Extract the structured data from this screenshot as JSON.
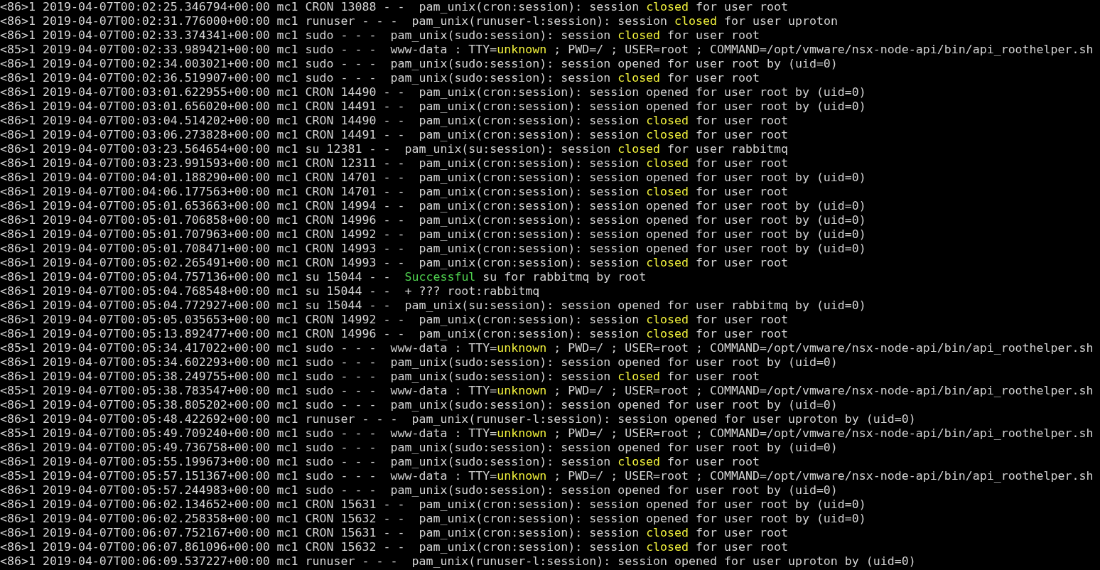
{
  "terminal": {
    "lines": [
      {
        "segments": [
          {
            "text": "<86>1 2019-04-07T00:02:25.346794+00:00 mc1 CRON 13088 - -  pam_unix(cron:session): session ",
            "kind": "plain"
          },
          {
            "text": "closed",
            "kind": "warning"
          },
          {
            "text": " for user root",
            "kind": "plain"
          }
        ]
      },
      {
        "segments": [
          {
            "text": "<86>1 2019-04-07T00:02:31.776000+00:00 mc1 runuser - - -  pam_unix(runuser-l:session): session ",
            "kind": "plain"
          },
          {
            "text": "closed",
            "kind": "warning"
          },
          {
            "text": " for user uproton",
            "kind": "plain"
          }
        ]
      },
      {
        "segments": [
          {
            "text": "<86>1 2019-04-07T00:02:33.374341+00:00 mc1 sudo - - -  pam_unix(sudo:session): session ",
            "kind": "plain"
          },
          {
            "text": "closed",
            "kind": "warning"
          },
          {
            "text": " for user root",
            "kind": "plain"
          }
        ]
      },
      {
        "segments": [
          {
            "text": "<85>1 2019-04-07T00:02:33.989421+00:00 mc1 sudo - - -  www-data : TTY=",
            "kind": "plain"
          },
          {
            "text": "unknown",
            "kind": "warning"
          },
          {
            "text": " ; PWD=/ ; USER=root ; COMMAND=/opt/vmware/nsx-node-api/bin/api_roothelper.sh",
            "kind": "plain"
          }
        ]
      },
      {
        "segments": [
          {
            "text": "<86>1 2019-04-07T00:02:34.003021+00:00 mc1 sudo - - -  pam_unix(sudo:session): session opened for user root by (uid=0)",
            "kind": "plain"
          }
        ]
      },
      {
        "segments": [
          {
            "text": "<86>1 2019-04-07T00:02:36.519907+00:00 mc1 sudo - - -  pam_unix(sudo:session): session ",
            "kind": "plain"
          },
          {
            "text": "closed",
            "kind": "warning"
          },
          {
            "text": " for user root",
            "kind": "plain"
          }
        ]
      },
      {
        "segments": [
          {
            "text": "<86>1 2019-04-07T00:03:01.622955+00:00 mc1 CRON 14490 - -  pam_unix(cron:session): session opened for user root by (uid=0)",
            "kind": "plain"
          }
        ]
      },
      {
        "segments": [
          {
            "text": "<86>1 2019-04-07T00:03:01.656020+00:00 mc1 CRON 14491 - -  pam_unix(cron:session): session opened for user root by (uid=0)",
            "kind": "plain"
          }
        ]
      },
      {
        "segments": [
          {
            "text": "<86>1 2019-04-07T00:03:04.514202+00:00 mc1 CRON 14490 - -  pam_unix(cron:session): session ",
            "kind": "plain"
          },
          {
            "text": "closed",
            "kind": "warning"
          },
          {
            "text": " for user root",
            "kind": "plain"
          }
        ]
      },
      {
        "segments": [
          {
            "text": "<86>1 2019-04-07T00:03:06.273828+00:00 mc1 CRON 14491 - -  pam_unix(cron:session): session ",
            "kind": "plain"
          },
          {
            "text": "closed",
            "kind": "warning"
          },
          {
            "text": " for user root",
            "kind": "plain"
          }
        ]
      },
      {
        "segments": [
          {
            "text": "<86>1 2019-04-07T00:03:23.564654+00:00 mc1 su 12381 - -  pam_unix(su:session): session ",
            "kind": "plain"
          },
          {
            "text": "closed",
            "kind": "warning"
          },
          {
            "text": " for user rabbitmq",
            "kind": "plain"
          }
        ]
      },
      {
        "segments": [
          {
            "text": "<86>1 2019-04-07T00:03:23.991593+00:00 mc1 CRON 12311 - -  pam_unix(cron:session): session ",
            "kind": "plain"
          },
          {
            "text": "closed",
            "kind": "warning"
          },
          {
            "text": " for user root",
            "kind": "plain"
          }
        ]
      },
      {
        "segments": [
          {
            "text": "<86>1 2019-04-07T00:04:01.188290+00:00 mc1 CRON 14701 - -  pam_unix(cron:session): session opened for user root by (uid=0)",
            "kind": "plain"
          }
        ]
      },
      {
        "segments": [
          {
            "text": "<86>1 2019-04-07T00:04:06.177563+00:00 mc1 CRON 14701 - -  pam_unix(cron:session): session ",
            "kind": "plain"
          },
          {
            "text": "closed",
            "kind": "warning"
          },
          {
            "text": " for user root",
            "kind": "plain"
          }
        ]
      },
      {
        "segments": [
          {
            "text": "<86>1 2019-04-07T00:05:01.653663+00:00 mc1 CRON 14994 - -  pam_unix(cron:session): session opened for user root by (uid=0)",
            "kind": "plain"
          }
        ]
      },
      {
        "segments": [
          {
            "text": "<86>1 2019-04-07T00:05:01.706858+00:00 mc1 CRON 14996 - -  pam_unix(cron:session): session opened for user root by (uid=0)",
            "kind": "plain"
          }
        ]
      },
      {
        "segments": [
          {
            "text": "<86>1 2019-04-07T00:05:01.707963+00:00 mc1 CRON 14992 - -  pam_unix(cron:session): session opened for user root by (uid=0)",
            "kind": "plain"
          }
        ]
      },
      {
        "segments": [
          {
            "text": "<86>1 2019-04-07T00:05:01.708471+00:00 mc1 CRON 14993 - -  pam_unix(cron:session): session opened for user root by (uid=0)",
            "kind": "plain"
          }
        ]
      },
      {
        "segments": [
          {
            "text": "<86>1 2019-04-07T00:05:02.265491+00:00 mc1 CRON 14993 - -  pam_unix(cron:session): session ",
            "kind": "plain"
          },
          {
            "text": "closed",
            "kind": "warning"
          },
          {
            "text": " for user root",
            "kind": "plain"
          }
        ]
      },
      {
        "segments": [
          {
            "text": "<86>1 2019-04-07T00:05:04.757136+00:00 mc1 su 15044 - -  ",
            "kind": "plain"
          },
          {
            "text": "Successful",
            "kind": "success"
          },
          {
            "text": " su for rabbitmq by root",
            "kind": "plain"
          }
        ]
      },
      {
        "segments": [
          {
            "text": "<86>1 2019-04-07T00:05:04.768548+00:00 mc1 su 15044 - -  + ??? root:rabbitmq",
            "kind": "plain"
          }
        ]
      },
      {
        "segments": [
          {
            "text": "<86>1 2019-04-07T00:05:04.772927+00:00 mc1 su 15044 - -  pam_unix(su:session): session opened for user rabbitmq by (uid=0)",
            "kind": "plain"
          }
        ]
      },
      {
        "segments": [
          {
            "text": "<86>1 2019-04-07T00:05:05.035653+00:00 mc1 CRON 14992 - -  pam_unix(cron:session): session ",
            "kind": "plain"
          },
          {
            "text": "closed",
            "kind": "warning"
          },
          {
            "text": " for user root",
            "kind": "plain"
          }
        ]
      },
      {
        "segments": [
          {
            "text": "<86>1 2019-04-07T00:05:13.892477+00:00 mc1 CRON 14996 - -  pam_unix(cron:session): session ",
            "kind": "plain"
          },
          {
            "text": "closed",
            "kind": "warning"
          },
          {
            "text": " for user root",
            "kind": "plain"
          }
        ]
      },
      {
        "segments": [
          {
            "text": "<85>1 2019-04-07T00:05:34.417022+00:00 mc1 sudo - - -  www-data : TTY=",
            "kind": "plain"
          },
          {
            "text": "unknown",
            "kind": "warning"
          },
          {
            "text": " ; PWD=/ ; USER=root ; COMMAND=/opt/vmware/nsx-node-api/bin/api_roothelper.sh",
            "kind": "plain"
          }
        ]
      },
      {
        "segments": [
          {
            "text": "<86>1 2019-04-07T00:05:34.602293+00:00 mc1 sudo - - -  pam_unix(sudo:session): session opened for user root by (uid=0)",
            "kind": "plain"
          }
        ]
      },
      {
        "segments": [
          {
            "text": "<86>1 2019-04-07T00:05:38.249755+00:00 mc1 sudo - - -  pam_unix(sudo:session): session ",
            "kind": "plain"
          },
          {
            "text": "closed",
            "kind": "warning"
          },
          {
            "text": " for user root",
            "kind": "plain"
          }
        ]
      },
      {
        "segments": [
          {
            "text": "<85>1 2019-04-07T00:05:38.783547+00:00 mc1 sudo - - -  www-data : TTY=",
            "kind": "plain"
          },
          {
            "text": "unknown",
            "kind": "warning"
          },
          {
            "text": " ; PWD=/ ; USER=root ; COMMAND=/opt/vmware/nsx-node-api/bin/api_roothelper.sh",
            "kind": "plain"
          }
        ]
      },
      {
        "segments": [
          {
            "text": "<86>1 2019-04-07T00:05:38.805202+00:00 mc1 sudo - - -  pam_unix(sudo:session): session opened for user root by (uid=0)",
            "kind": "plain"
          }
        ]
      },
      {
        "segments": [
          {
            "text": "<86>1 2019-04-07T00:05:48.422692+00:00 mc1 runuser - - -  pam_unix(runuser-l:session): session opened for user uproton by (uid=0)",
            "kind": "plain"
          }
        ]
      },
      {
        "segments": [
          {
            "text": "<85>1 2019-04-07T00:05:49.709240+00:00 mc1 sudo - - -  www-data : TTY=",
            "kind": "plain"
          },
          {
            "text": "unknown",
            "kind": "warning"
          },
          {
            "text": " ; PWD=/ ; USER=root ; COMMAND=/opt/vmware/nsx-node-api/bin/api_roothelper.sh",
            "kind": "plain"
          }
        ]
      },
      {
        "segments": [
          {
            "text": "<86>1 2019-04-07T00:05:49.736758+00:00 mc1 sudo - - -  pam_unix(sudo:session): session opened for user root by (uid=0)",
            "kind": "plain"
          }
        ]
      },
      {
        "segments": [
          {
            "text": "<86>1 2019-04-07T00:05:55.199673+00:00 mc1 sudo - - -  pam_unix(sudo:session): session ",
            "kind": "plain"
          },
          {
            "text": "closed",
            "kind": "warning"
          },
          {
            "text": " for user root",
            "kind": "plain"
          }
        ]
      },
      {
        "segments": [
          {
            "text": "<85>1 2019-04-07T00:05:57.151367+00:00 mc1 sudo - - -  www-data : TTY=",
            "kind": "plain"
          },
          {
            "text": "unknown",
            "kind": "warning"
          },
          {
            "text": " ; PWD=/ ; USER=root ; COMMAND=/opt/vmware/nsx-node-api/bin/api_roothelper.sh",
            "kind": "plain"
          }
        ]
      },
      {
        "segments": [
          {
            "text": "<86>1 2019-04-07T00:05:57.244983+00:00 mc1 sudo - - -  pam_unix(sudo:session): session opened for user root by (uid=0)",
            "kind": "plain"
          }
        ]
      },
      {
        "segments": [
          {
            "text": "<86>1 2019-04-07T00:06:02.134652+00:00 mc1 CRON 15631 - -  pam_unix(cron:session): session opened for user root by (uid=0)",
            "kind": "plain"
          }
        ]
      },
      {
        "segments": [
          {
            "text": "<86>1 2019-04-07T00:06:02.258358+00:00 mc1 CRON 15632 - -  pam_unix(cron:session): session opened for user root by (uid=0)",
            "kind": "plain"
          }
        ]
      },
      {
        "segments": [
          {
            "text": "<86>1 2019-04-07T00:06:07.752167+00:00 mc1 CRON 15631 - -  pam_unix(cron:session): session ",
            "kind": "plain"
          },
          {
            "text": "closed",
            "kind": "warning"
          },
          {
            "text": " for user root",
            "kind": "plain"
          }
        ]
      },
      {
        "segments": [
          {
            "text": "<86>1 2019-04-07T00:06:07.861096+00:00 mc1 CRON 15632 - -  pam_unix(cron:session): session ",
            "kind": "plain"
          },
          {
            "text": "closed",
            "kind": "warning"
          },
          {
            "text": " for user root",
            "kind": "plain"
          }
        ]
      },
      {
        "segments": [
          {
            "text": "<86>1 2019-04-07T00:06:09.537227+00:00 mc1 runuser - - -  pam_unix(runuser-l:session): session opened for user uproton by (uid=0)",
            "kind": "plain"
          }
        ]
      }
    ]
  }
}
